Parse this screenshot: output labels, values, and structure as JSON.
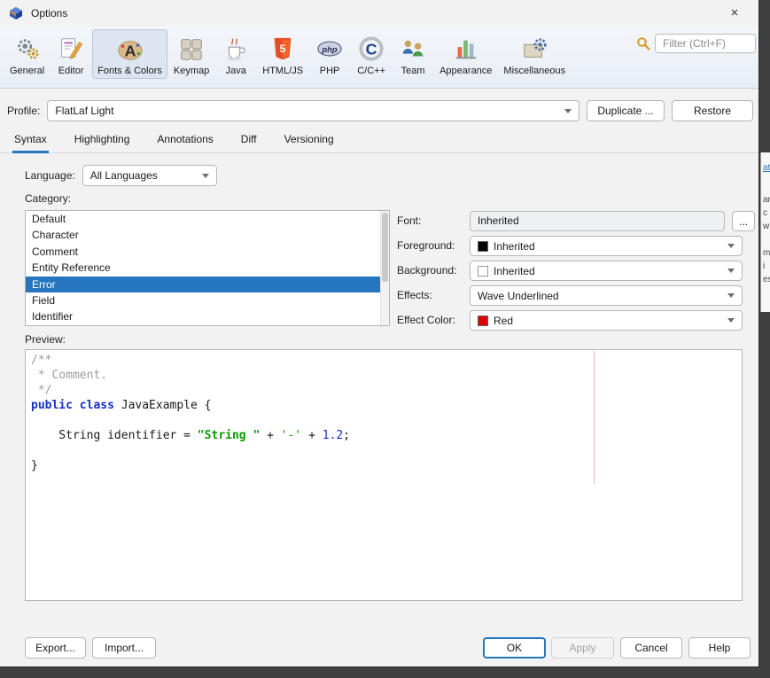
{
  "window": {
    "title": "Options",
    "close_glyph": "×"
  },
  "filter": {
    "placeholder": "Filter (Ctrl+F)"
  },
  "toolbar": {
    "selected": "Fonts & Colors",
    "items": [
      {
        "label": "General"
      },
      {
        "label": "Editor"
      },
      {
        "label": "Fonts & Colors"
      },
      {
        "label": "Keymap"
      },
      {
        "label": "Java"
      },
      {
        "label": "HTML/JS"
      },
      {
        "label": "PHP"
      },
      {
        "label": "C/C++"
      },
      {
        "label": "Team"
      },
      {
        "label": "Appearance"
      },
      {
        "label": "Miscellaneous"
      }
    ]
  },
  "profile": {
    "label": "Profile:",
    "value": "FlatLaf Light",
    "duplicate_label": "Duplicate ...",
    "restore_label": "Restore"
  },
  "tabs": {
    "selected": "Syntax",
    "items": [
      "Syntax",
      "Highlighting",
      "Annotations",
      "Diff",
      "Versioning"
    ]
  },
  "language": {
    "label": "Language:",
    "value": "All Languages"
  },
  "category": {
    "label": "Category:",
    "selected": "Error",
    "items": [
      "Default",
      "Character",
      "Comment",
      "Entity Reference",
      "Error",
      "Field",
      "Identifier"
    ]
  },
  "attributes": {
    "font": {
      "label": "Font:",
      "value": "Inherited",
      "more_label": "..."
    },
    "foreground": {
      "label": "Foreground:",
      "value": "Inherited",
      "swatch": "#000000"
    },
    "background": {
      "label": "Background:",
      "value": "Inherited",
      "swatch": "#ffffff"
    },
    "effects": {
      "label": "Effects:",
      "value": "Wave Underlined"
    },
    "effect_color": {
      "label": "Effect Color:",
      "value": "Red",
      "swatch": "#e00000"
    }
  },
  "preview": {
    "label": "Preview:",
    "margin_line_color": "#efb4b4",
    "lines": [
      [
        {
          "t": "/**",
          "c": "comment"
        }
      ],
      [
        {
          "t": " * Comment.",
          "c": "comment"
        }
      ],
      [
        {
          "t": " */",
          "c": "comment"
        }
      ],
      [
        {
          "t": "public class",
          "c": "keyword"
        },
        {
          "t": " JavaExample {",
          "c": "plain"
        }
      ],
      [],
      [
        {
          "t": "    String identifier = ",
          "c": "plain"
        },
        {
          "t": "\"String \"",
          "c": "string"
        },
        {
          "t": " + ",
          "c": "plain"
        },
        {
          "t": "'-'",
          "c": "char"
        },
        {
          "t": " + ",
          "c": "plain"
        },
        {
          "t": "1.2",
          "c": "number"
        },
        {
          "t": ";",
          "c": "plain"
        }
      ],
      [],
      [
        {
          "t": "}",
          "c": "plain"
        }
      ]
    ]
  },
  "footer": {
    "export_label": "Export...",
    "import_label": "Import...",
    "ok_label": "OK",
    "apply_label": "Apply",
    "cancel_label": "Cancel",
    "help_label": "Help"
  },
  "background_window": {
    "fragments": [
      "ate",
      "ans",
      "c",
      "w",
      "ma",
      "i",
      "es"
    ]
  },
  "colors": {
    "accent": "#2675bf",
    "selection": "#2675bf"
  }
}
